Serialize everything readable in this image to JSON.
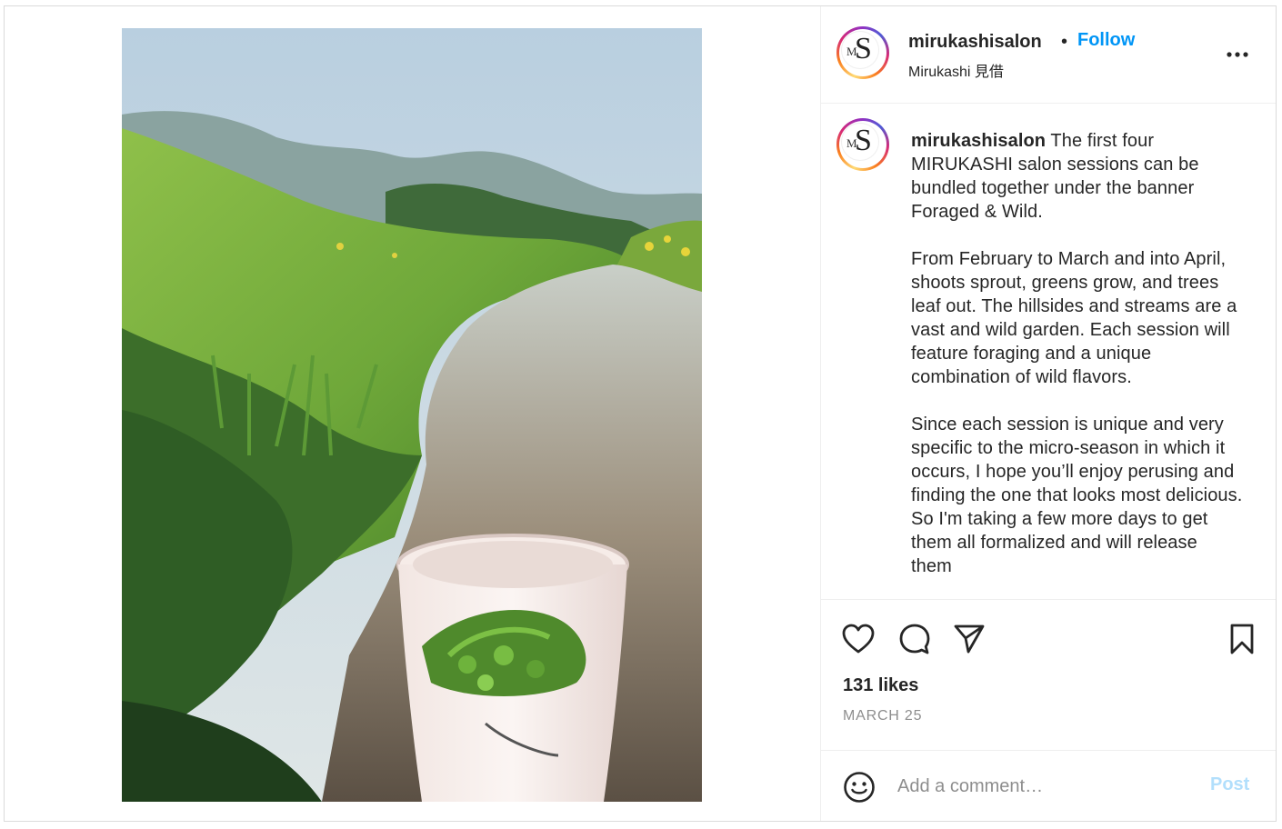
{
  "post": {
    "username": "mirukashisalon",
    "separator": "•",
    "follow_label": "Follow",
    "location": "Mirukashi 見借",
    "avatar_monogram_m": "M",
    "avatar_monogram_s": "S",
    "caption_username": "mirukashisalon",
    "caption_body": " The first four MIRUKASHI salon sessions can be bundled together under the banner Foraged & Wild.\n\nFrom February to March and into April, shoots sprout, greens grow, and trees leaf out. The hillsides and streams are a vast and wild garden. Each session will feature foraging and a unique combination of wild flavors.\n\nSince each session is unique and very specific to the micro-season in which it occurs, I hope you’ll enjoy perusing and finding the one that looks most delicious. So I'm taking a few more days to get them all formalized and will release them",
    "likes": "131 likes",
    "date": "MARCH 25"
  },
  "comment": {
    "placeholder": "Add a comment…",
    "post_label": "Post"
  },
  "colors": {
    "accent": "#0095f6",
    "post_disabled": "#b2dffc",
    "muted": "#8e8e8e"
  },
  "icons": {
    "more": "more-options-icon",
    "like": "heart-icon",
    "comment": "comment-bubble-icon",
    "share": "paper-plane-icon",
    "save": "bookmark-icon",
    "emoji": "smiley-icon"
  }
}
